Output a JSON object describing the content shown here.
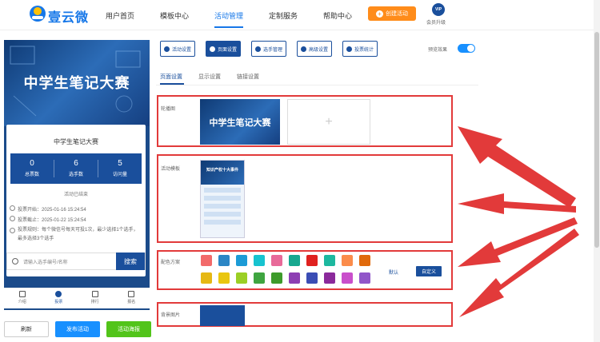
{
  "brand": {
    "name": "壹云微"
  },
  "nav": {
    "items": [
      {
        "label": "用户首页"
      },
      {
        "label": "模板中心"
      },
      {
        "label": "活动管理"
      },
      {
        "label": "定制服务"
      },
      {
        "label": "帮助中心"
      }
    ],
    "active": "活动管理",
    "create_label": "创建活动",
    "vip_badge": "VIP",
    "vip_label": "会员升级"
  },
  "preview": {
    "banner_title": "中学生笔记大赛",
    "card_title": "中学生笔记大赛",
    "stats": [
      {
        "value": "0",
        "label": "总票数"
      },
      {
        "value": "6",
        "label": "选手数"
      },
      {
        "value": "5",
        "label": "访问量"
      }
    ],
    "status": "活动已结束",
    "start_time": "投票开始：2025-01-16 15:24:54",
    "end_time": "投票截止：2025-01-22 15:24:54",
    "rule": "投票规则：每个微信号每天可投1次，最少选择1个选手，最多选择3个选手",
    "search_placeholder": "请输入选手编号/名称",
    "search_button": "搜索",
    "tabs": [
      {
        "label": "介绍"
      },
      {
        "label": "投票"
      },
      {
        "label": "排行"
      },
      {
        "label": "报名"
      }
    ],
    "active_tab": "投票"
  },
  "actions": {
    "refresh": "刷新",
    "publish": "发布活动",
    "poster": "活动海报"
  },
  "toolbar": {
    "buttons": [
      {
        "label": "活动设置"
      },
      {
        "label": "页面设置"
      },
      {
        "label": "选手管理"
      },
      {
        "label": "高级设置"
      },
      {
        "label": "投票统计"
      }
    ],
    "active": "页面设置",
    "preview_label": "预览效果",
    "preview_on": true
  },
  "subtabs": {
    "items": [
      {
        "label": "页面设置"
      },
      {
        "label": "显示设置"
      },
      {
        "label": "链接设置"
      }
    ],
    "active": "页面设置"
  },
  "sections": {
    "carousel_label": "轮播图",
    "carousel_image_title": "中学生笔记大赛",
    "add_symbol": "+",
    "template_label": "活动模板",
    "template_title": "知识产权十大事件",
    "color_label": "配色方案",
    "color_default": "默认",
    "color_custom": "自定义",
    "bg_label": "背景图片"
  },
  "colors": {
    "row1": [
      "#f26a6a",
      "#2b86c5",
      "#1c9bd6",
      "#17c3cf",
      "#e86a99",
      "#17a88f",
      "#e0211f",
      "#1db89f",
      "#fb8c4b",
      "#e06a0c"
    ],
    "row2": [
      "#e6b814",
      "#e9c60f",
      "#9bcf25",
      "#3fa540",
      "#3e9b2b",
      "#8d3fb3",
      "#3b4db5",
      "#8b2a9b",
      "#c94fcb",
      "#9156c9"
    ],
    "accent": "#1a4f9c",
    "highlight": "#e23a3a"
  }
}
